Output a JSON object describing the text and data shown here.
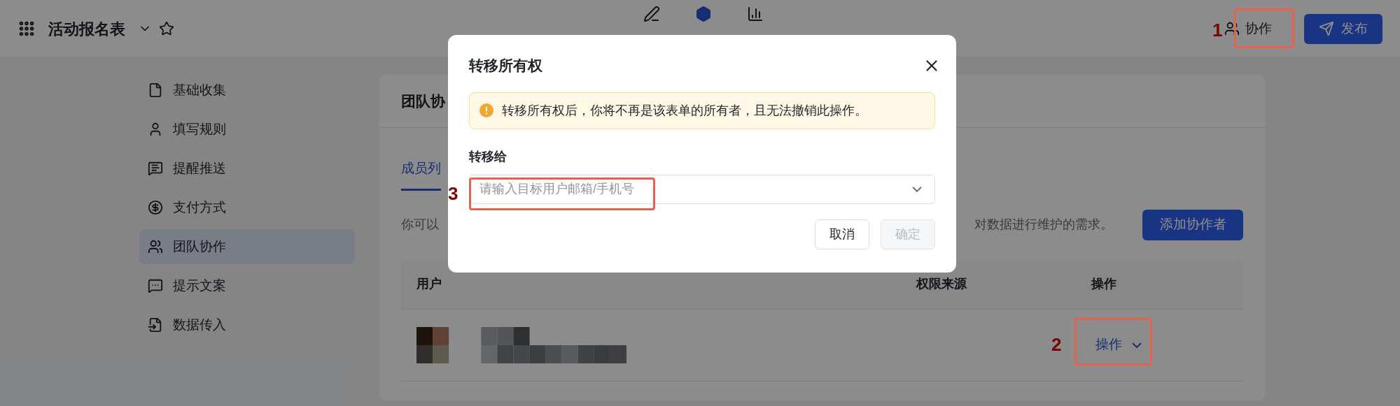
{
  "header": {
    "title": "活动报名表",
    "nav": [
      {
        "selected": false
      },
      {
        "selected": true
      },
      {
        "selected": false
      }
    ],
    "collaborate_button": "协作",
    "publish_button": "发布"
  },
  "sidebar": {
    "items": [
      {
        "label": "基础收集",
        "selected": false
      },
      {
        "label": "填写规则",
        "selected": false
      },
      {
        "label": "提醒推送",
        "selected": false
      },
      {
        "label": "支付方式",
        "selected": false
      },
      {
        "label": "团队协作",
        "selected": true
      },
      {
        "label": "提示文案",
        "selected": false
      },
      {
        "label": "数据传入",
        "selected": false
      }
    ]
  },
  "card": {
    "title": "团队协",
    "tabs": [
      {
        "label": "成员列",
        "selected": true
      }
    ],
    "description_start": "你可以",
    "description_end": "对数据进行维护的需求。",
    "add_button": "添加协作者",
    "table": {
      "columns": [
        "用户",
        "权限来源",
        "操作"
      ],
      "rows": [
        {
          "action": "操作"
        }
      ]
    }
  },
  "dialog": {
    "title": "转移所有权",
    "warning": "转移所有权后，你将不再是该表单的所有者，且无法撤销此操作。",
    "field_label": "转移给",
    "placeholder": "请输入目标用户邮箱/手机号",
    "buttons": [
      {
        "label": "取消",
        "disabled": false
      },
      {
        "label": "确定",
        "disabled": true
      }
    ]
  },
  "annotations": [
    {
      "number": "1"
    },
    {
      "number": "2"
    },
    {
      "number": "3"
    }
  ]
}
